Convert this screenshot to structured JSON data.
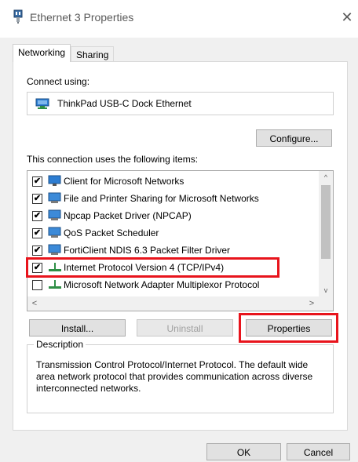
{
  "window": {
    "title": "Ethernet 3 Properties",
    "close_glyph": "✕"
  },
  "tabs": [
    {
      "label": "Networking",
      "active": true
    },
    {
      "label": "Sharing",
      "active": false
    }
  ],
  "connect_using": {
    "label": "Connect using:",
    "adapter": "ThinkPad USB-C Dock Ethernet",
    "configure_label": "Configure..."
  },
  "items_section": {
    "label": "This connection uses the following items:",
    "items": [
      {
        "label": "Client for Microsoft Networks",
        "checked": true,
        "icon": "network-client-icon"
      },
      {
        "label": "File and Printer Sharing for Microsoft Networks",
        "checked": true,
        "icon": "network-service-icon"
      },
      {
        "label": "Npcap Packet Driver (NPCAP)",
        "checked": true,
        "icon": "network-service-icon"
      },
      {
        "label": "QoS Packet Scheduler",
        "checked": true,
        "icon": "network-service-icon"
      },
      {
        "label": "FortiClient NDIS 6.3 Packet Filter Driver",
        "checked": true,
        "icon": "network-service-icon"
      },
      {
        "label": "Internet Protocol Version 4 (TCP/IPv4)",
        "checked": true,
        "icon": "protocol-icon"
      },
      {
        "label": "Microsoft Network Adapter Multiplexor Protocol",
        "checked": false,
        "icon": "protocol-icon"
      }
    ],
    "check_glyph": "✔",
    "scroll_up": "^",
    "scroll_down": "v",
    "scroll_left": "<",
    "scroll_right": ">"
  },
  "buttons": {
    "install": "Install...",
    "uninstall": "Uninstall",
    "properties": "Properties",
    "ok": "OK",
    "cancel": "Cancel"
  },
  "description": {
    "legend": "Description",
    "text": "Transmission Control Protocol/Internet Protocol. The default wide area network protocol that provides communication across diverse interconnected networks."
  },
  "colors": {
    "highlight": "#e8141c",
    "dialog_bg": "#f0f0f0"
  }
}
